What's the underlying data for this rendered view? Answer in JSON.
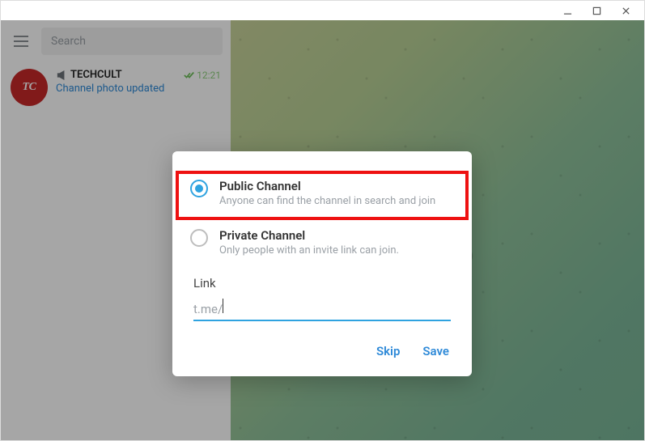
{
  "titlebar": {
    "min_tooltip": "Minimize",
    "max_tooltip": "Maximize",
    "close_tooltip": "Close"
  },
  "search": {
    "placeholder": "Search"
  },
  "chat": {
    "avatar_initials": "TC",
    "name": "TECHCULT",
    "time": "12:21",
    "subtitle": "Channel photo updated"
  },
  "background_badge": "messaging",
  "modal": {
    "options": [
      {
        "title": "Public Channel",
        "desc": "Anyone can find the channel in search and join",
        "selected": true
      },
      {
        "title": "Private Channel",
        "desc": "Only people with an invite link can join.",
        "selected": false
      }
    ],
    "link_label": "Link",
    "link_prefix": "t.me/",
    "link_value": "",
    "skip_label": "Skip",
    "save_label": "Save"
  }
}
